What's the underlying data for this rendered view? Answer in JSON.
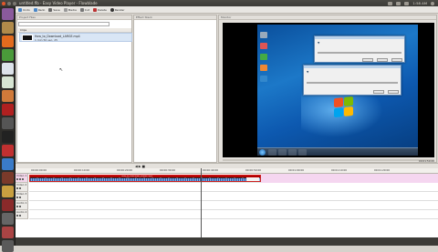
{
  "window": {
    "title": "untitled.flb - Easy Video Player - Flowblade"
  },
  "topbar": {
    "time": "1:58 AM"
  },
  "toolbar": {
    "buttons": [
      "Undo",
      "Redo",
      "Save",
      "Media",
      "Cut",
      "Delete",
      "Render"
    ]
  },
  "panels": {
    "project_files": "Project Files",
    "effects": "Effect Stack",
    "preview": "Monitor"
  },
  "file": {
    "name": "How_to_Download_LARGE.mp4",
    "meta": "1 min 50 sec, 25"
  },
  "file_list_header": "Clips",
  "preview": {
    "timecode": "00:01:50:20"
  },
  "timeline_tabs": [
    "Project Files",
    "Effect Stack",
    "Render"
  ],
  "monitor_tabs": [
    "Monitor",
    "Monitor Preview"
  ],
  "ruler": [
    "00:00:00:00",
    "00:00:10:00",
    "00:00:20:00",
    "00:00:30:00",
    "00:00:40:00",
    "00:00:50:00",
    "00:01:00:00",
    "00:01:10:00",
    "00:01:20:00"
  ],
  "tracks": [
    "Video 1",
    "Video 2",
    "Video 3",
    "Audio 1",
    "Audio 2"
  ],
  "clip": {
    "title": "How_to_Download_LARGE.mp4"
  },
  "status": {
    "left": "",
    "right": ""
  },
  "colors": {
    "accent": "#cc2020",
    "selection": "#d9e6f5",
    "pink": "#f5d6f0"
  }
}
